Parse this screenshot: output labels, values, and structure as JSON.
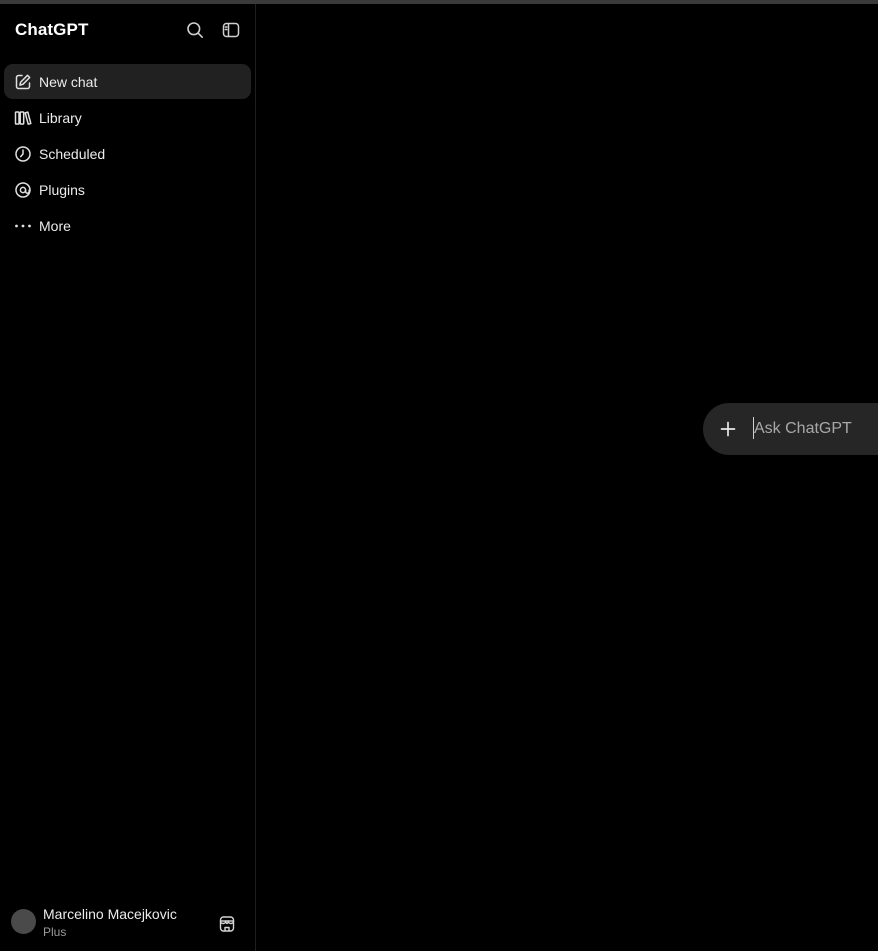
{
  "app": {
    "brand": "ChatGPT"
  },
  "sidebar": {
    "items": [
      {
        "label": "New chat",
        "icon": "new-chat-icon",
        "active": true
      },
      {
        "label": "Library",
        "icon": "library-icon",
        "active": false
      },
      {
        "label": "Scheduled",
        "icon": "clock-icon",
        "active": false
      },
      {
        "label": "Plugins",
        "icon": "plugins-icon",
        "active": false
      },
      {
        "label": "More",
        "icon": "more-dots-icon",
        "active": false
      }
    ]
  },
  "user": {
    "name": "Marcelino Macejkovic",
    "plan": "Plus"
  },
  "composer": {
    "placeholder": "Ask ChatGPT",
    "value": ""
  },
  "colors": {
    "background": "#000000",
    "sidebar_active": "#212121",
    "composer_bg": "#262626",
    "text": "#ececec",
    "muted_text": "#9b9b9b"
  }
}
